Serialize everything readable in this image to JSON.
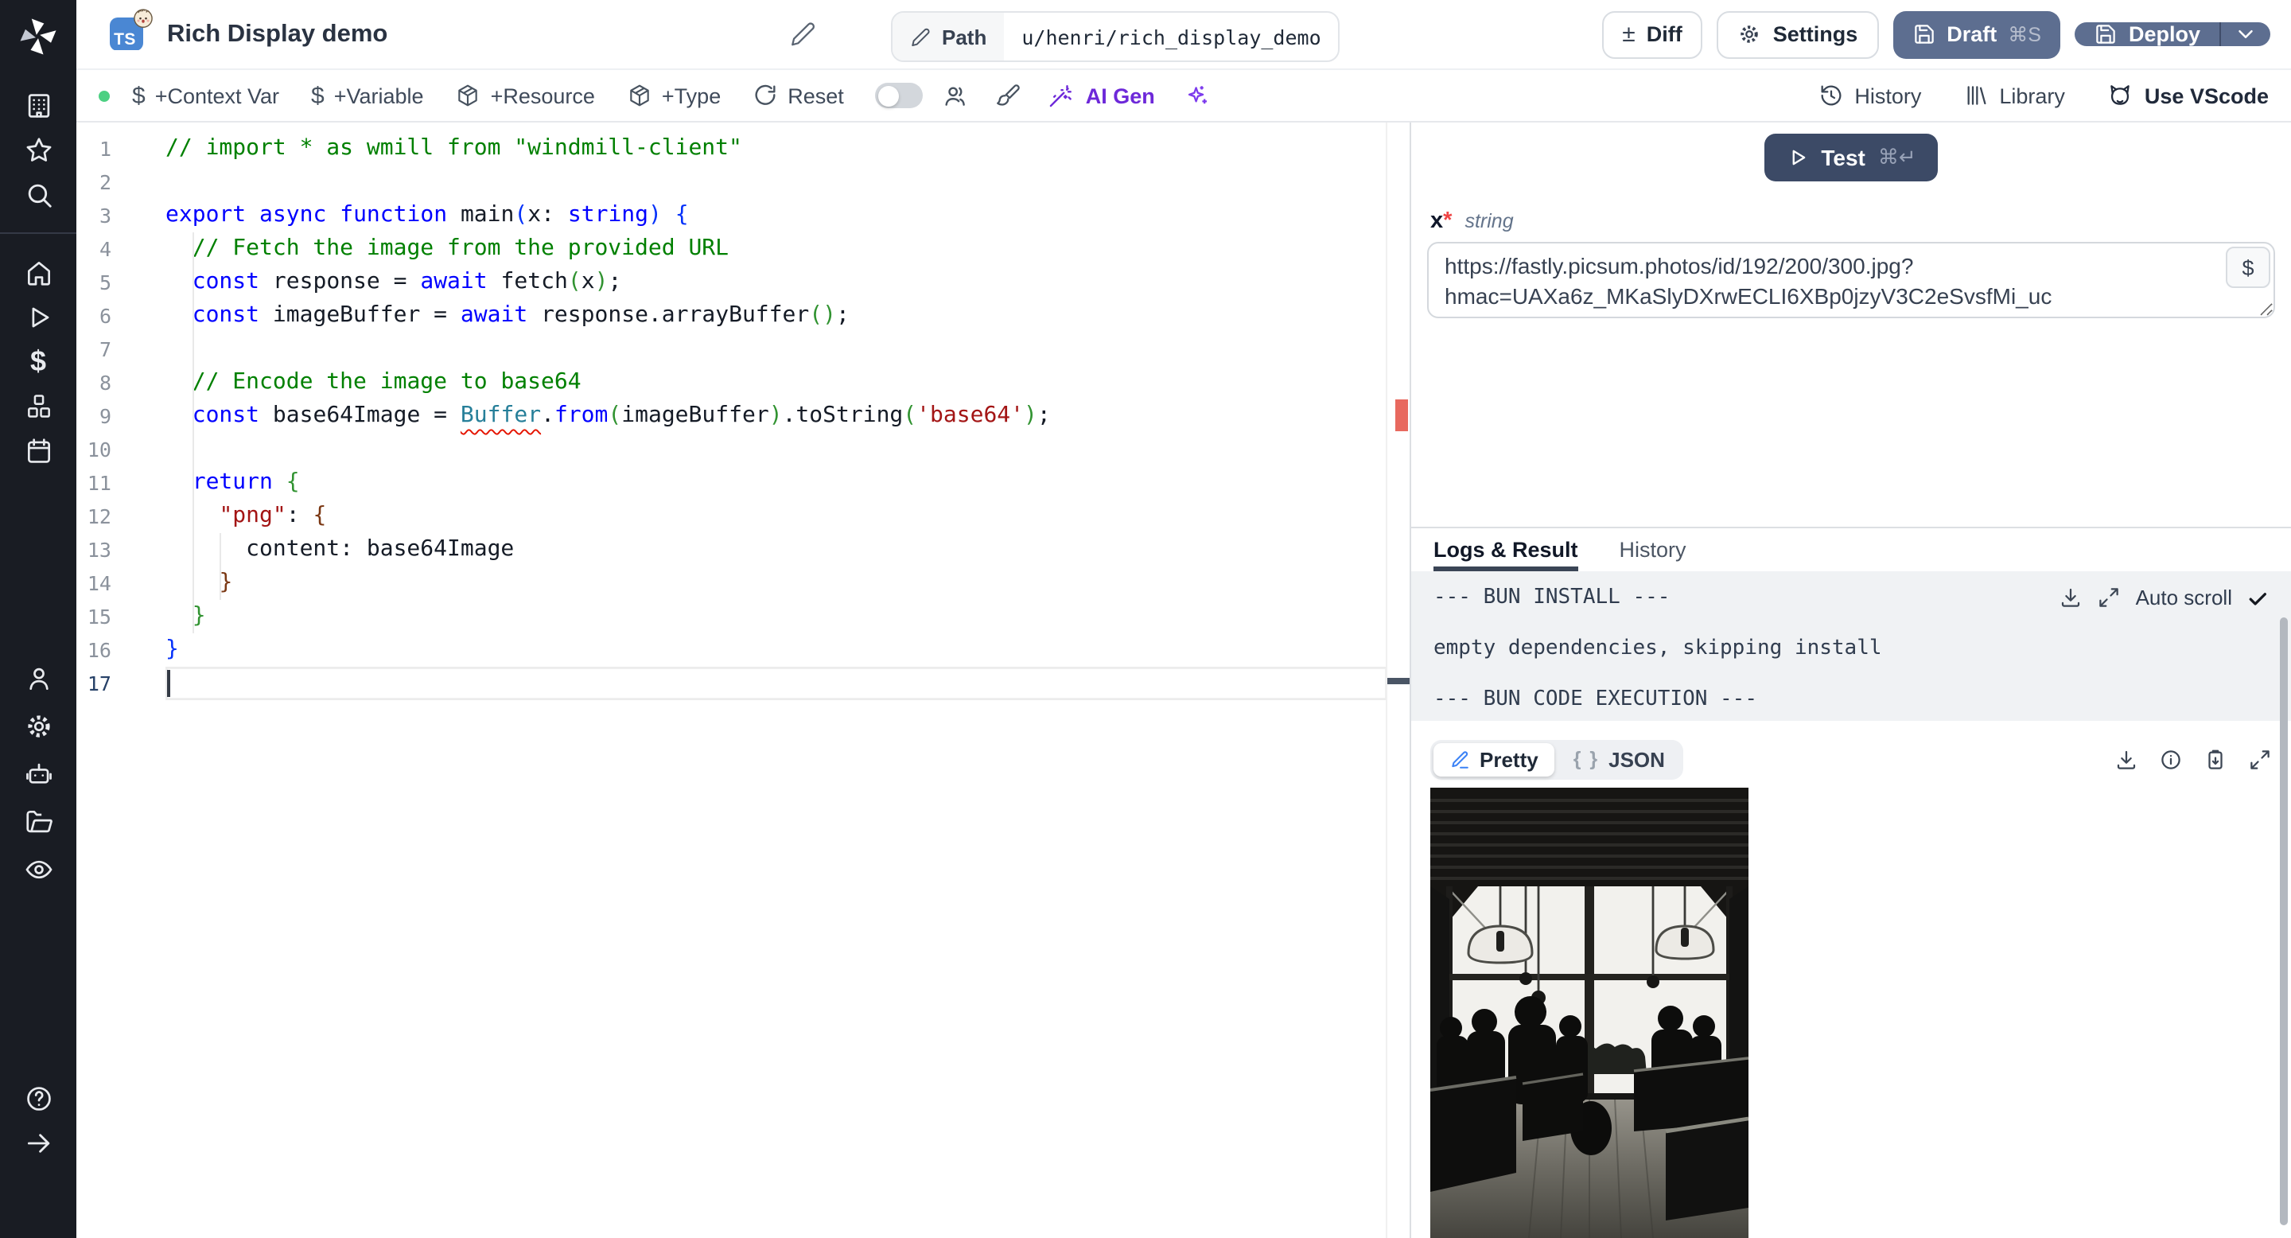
{
  "app": {
    "title": "Rich Display demo",
    "language_badge": "TS",
    "status_dot_color": "#4cd082",
    "accent_slate": "#5d6e90",
    "accent_navy": "#3c4a66",
    "accent_purple": "#6d28d9"
  },
  "header": {
    "path_label": "Path",
    "path_value": "u/henri/rich_display_demo",
    "diff_label": "Diff",
    "diff_glyph": "±",
    "settings_label": "Settings",
    "draft_label": "Draft",
    "draft_shortcut": "⌘S",
    "deploy_label": "Deploy"
  },
  "toolbar": {
    "add_context_var": "+Context Var",
    "add_variable": "+Variable",
    "add_resource": "+Resource",
    "add_type": "+Type",
    "reset": "Reset",
    "ai_gen": "AI Gen",
    "history": "History",
    "library": "Library",
    "use_vscode": "Use VScode",
    "dollar_glyph": "$"
  },
  "sidebar": {
    "icons": [
      "windmill-logo",
      "building",
      "star",
      "search",
      "home",
      "play",
      "dollar",
      "boxes",
      "calendar",
      "user",
      "gear",
      "robot",
      "folder-open",
      "eye",
      "help-circle",
      "arrow-right"
    ]
  },
  "editor": {
    "active_line": 17,
    "lines": [
      [
        [
          "// import * as wmill from \"windmill-client\"",
          "c"
        ]
      ],
      [],
      [
        [
          "export",
          "k"
        ],
        [
          " ",
          "p"
        ],
        [
          "async",
          "k"
        ],
        [
          " ",
          "p"
        ],
        [
          "function",
          "k"
        ],
        [
          " main",
          "p"
        ],
        [
          "(",
          "b1"
        ],
        [
          "x",
          "p"
        ],
        [
          ": ",
          "p"
        ],
        [
          "string",
          "k"
        ],
        [
          ")",
          "b1"
        ],
        [
          " ",
          "p"
        ],
        [
          "{",
          "b1"
        ]
      ],
      [
        [
          "  ",
          "p"
        ],
        [
          "// Fetch the image from the provided URL",
          "c"
        ]
      ],
      [
        [
          "  ",
          "p"
        ],
        [
          "const",
          "k"
        ],
        [
          " response = ",
          "p"
        ],
        [
          "await",
          "k"
        ],
        [
          " fetch",
          "p"
        ],
        [
          "(",
          "b2"
        ],
        [
          "x",
          "p"
        ],
        [
          ")",
          "b2"
        ],
        [
          ";",
          "p"
        ]
      ],
      [
        [
          "  ",
          "p"
        ],
        [
          "const",
          "k"
        ],
        [
          " imageBuffer = ",
          "p"
        ],
        [
          "await",
          "k"
        ],
        [
          " response.arrayBuffer",
          "p"
        ],
        [
          "(",
          "b2"
        ],
        [
          ")",
          "b2"
        ],
        [
          ";",
          "p"
        ]
      ],
      [],
      [
        [
          "  ",
          "p"
        ],
        [
          "// Encode the image to base64",
          "c"
        ]
      ],
      [
        [
          "  ",
          "p"
        ],
        [
          "const",
          "k"
        ],
        [
          " base64Image = ",
          "p"
        ],
        [
          "Buffer",
          "te"
        ],
        [
          ".",
          "p"
        ],
        [
          "from",
          "k"
        ],
        [
          "(",
          "b2"
        ],
        [
          "imageBuffer",
          "p"
        ],
        [
          ")",
          "b2"
        ],
        [
          ".toString",
          "p"
        ],
        [
          "(",
          "b2"
        ],
        [
          "'base64'",
          "s"
        ],
        [
          ")",
          "b2"
        ],
        [
          ";",
          "p"
        ]
      ],
      [],
      [
        [
          "  ",
          "p"
        ],
        [
          "return",
          "k"
        ],
        [
          " ",
          "p"
        ],
        [
          "{",
          "b2"
        ]
      ],
      [
        [
          "    ",
          "p"
        ],
        [
          "\"png\"",
          "s"
        ],
        [
          ": ",
          "p"
        ],
        [
          "{",
          "b3"
        ]
      ],
      [
        [
          "      content: base64Image",
          "p"
        ]
      ],
      [
        [
          "    ",
          "p"
        ],
        [
          "}",
          "b3"
        ]
      ],
      [
        [
          "  ",
          "p"
        ],
        [
          "}",
          "b2"
        ]
      ],
      [
        [
          "}",
          "b1"
        ]
      ],
      []
    ]
  },
  "run": {
    "test_label": "Test",
    "test_shortcut": "⌘↵",
    "arg_name": "x",
    "arg_required_mark": "*",
    "arg_type": "string",
    "arg_value": "https://fastly.picsum.photos/id/192/200/300.jpg?hmac=UAXa6z_MKaSlyDXrwECLI6XBp0jzyV3C2eSvsfMi_uc",
    "insert_var_glyph": "$"
  },
  "results": {
    "tabs": [
      "Logs & Result",
      "History"
    ],
    "active_tab": "Logs & Result",
    "autoscroll_label": "Auto scroll",
    "log_lines": [
      "--- BUN INSTALL ---",
      "",
      "empty dependencies, skipping install",
      "",
      "--- BUN CODE EXECUTION ---"
    ],
    "view_modes": [
      "Pretty",
      "JSON"
    ],
    "active_view": "Pretty",
    "json_glyph": "{ }",
    "result_image_description": "black and white photo of a cafe interior: dark slatted ceiling, large bright windows, pendant lamps, silhouettes of people at tables"
  }
}
